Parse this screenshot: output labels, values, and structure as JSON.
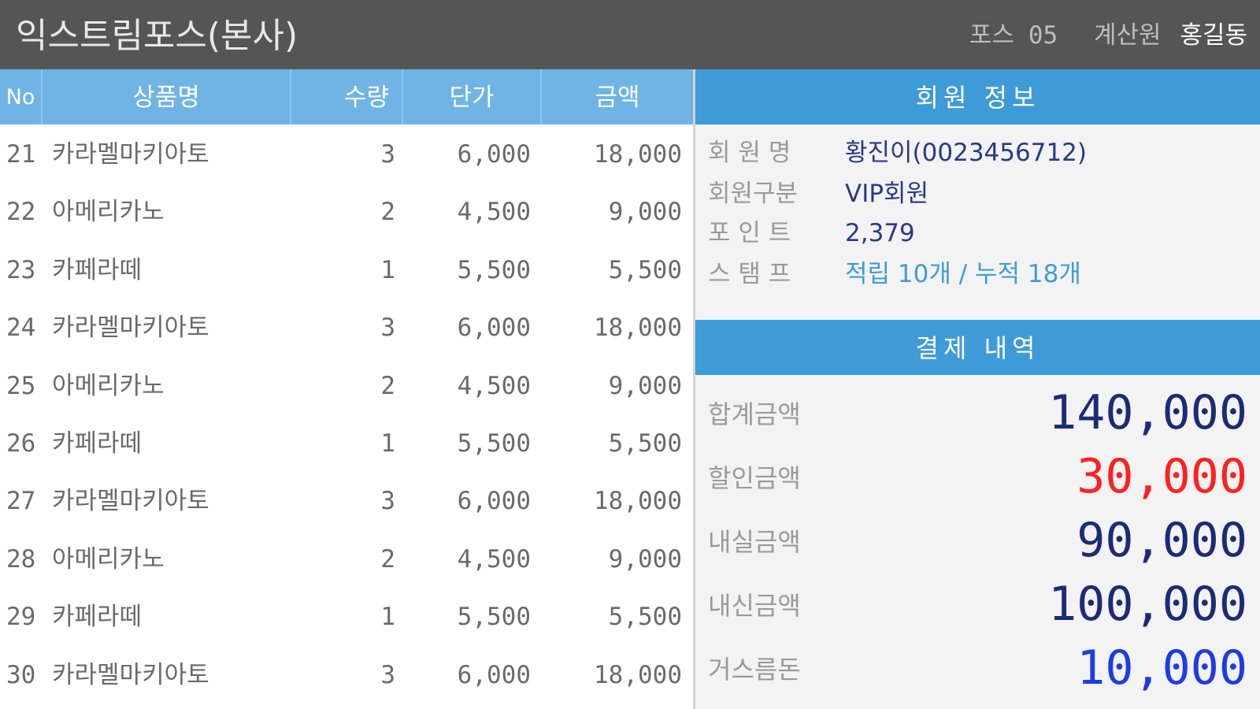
{
  "header": {
    "title": "익스트림포스(본사)",
    "pos_label": "포스",
    "pos_no": "05",
    "cashier_label": "계산원",
    "cashier_name": "홍길동"
  },
  "table": {
    "columns": [
      "No",
      "상품명",
      "수량",
      "단가",
      "금액"
    ],
    "rows": [
      {
        "no": "21",
        "name": "카라멜마키아토",
        "qty": "3",
        "price": "6,000",
        "amount": "18,000"
      },
      {
        "no": "22",
        "name": "아메리카노",
        "qty": "2",
        "price": "4,500",
        "amount": "9,000"
      },
      {
        "no": "23",
        "name": "카페라떼",
        "qty": "1",
        "price": "5,500",
        "amount": "5,500"
      },
      {
        "no": "24",
        "name": "카라멜마키아토",
        "qty": "3",
        "price": "6,000",
        "amount": "18,000"
      },
      {
        "no": "25",
        "name": "아메리카노",
        "qty": "2",
        "price": "4,500",
        "amount": "9,000"
      },
      {
        "no": "26",
        "name": "카페라떼",
        "qty": "1",
        "price": "5,500",
        "amount": "5,500"
      },
      {
        "no": "27",
        "name": "카라멜마키아토",
        "qty": "3",
        "price": "6,000",
        "amount": "18,000"
      },
      {
        "no": "28",
        "name": "아메리카노",
        "qty": "2",
        "price": "4,500",
        "amount": "9,000"
      },
      {
        "no": "29",
        "name": "카페라떼",
        "qty": "1",
        "price": "5,500",
        "amount": "5,500"
      },
      {
        "no": "30",
        "name": "카라멜마키아토",
        "qty": "3",
        "price": "6,000",
        "amount": "18,000"
      }
    ]
  },
  "member": {
    "header": "회원 정보",
    "name_label": "회 원 명",
    "name_value": "황진이(0023456712)",
    "grade_label": "회원구분",
    "grade_value": "VIP회원",
    "point_label": "포 인 트",
    "point_value": "2,379",
    "stamp_label": "스 탬 프",
    "stamp_value": "적립 10개 / 누적 18개"
  },
  "payment": {
    "header": "결제 내역",
    "items": [
      {
        "label": "합계금액",
        "value": "140,000",
        "color": "#1c2a78"
      },
      {
        "label": "할인금액",
        "value": "30,000",
        "color": "#ff2020"
      },
      {
        "label": "내실금액",
        "value": "90,000",
        "color": "#1c2a78"
      },
      {
        "label": "내신금액",
        "value": "100,000",
        "color": "#1c2a78"
      },
      {
        "label": "거스름돈",
        "value": "10,000",
        "color": "#1f3be6"
      }
    ]
  },
  "colors": {
    "titlebar": "#555555",
    "table_header": "#6fb4e5",
    "section_header": "#3f9bd8"
  }
}
